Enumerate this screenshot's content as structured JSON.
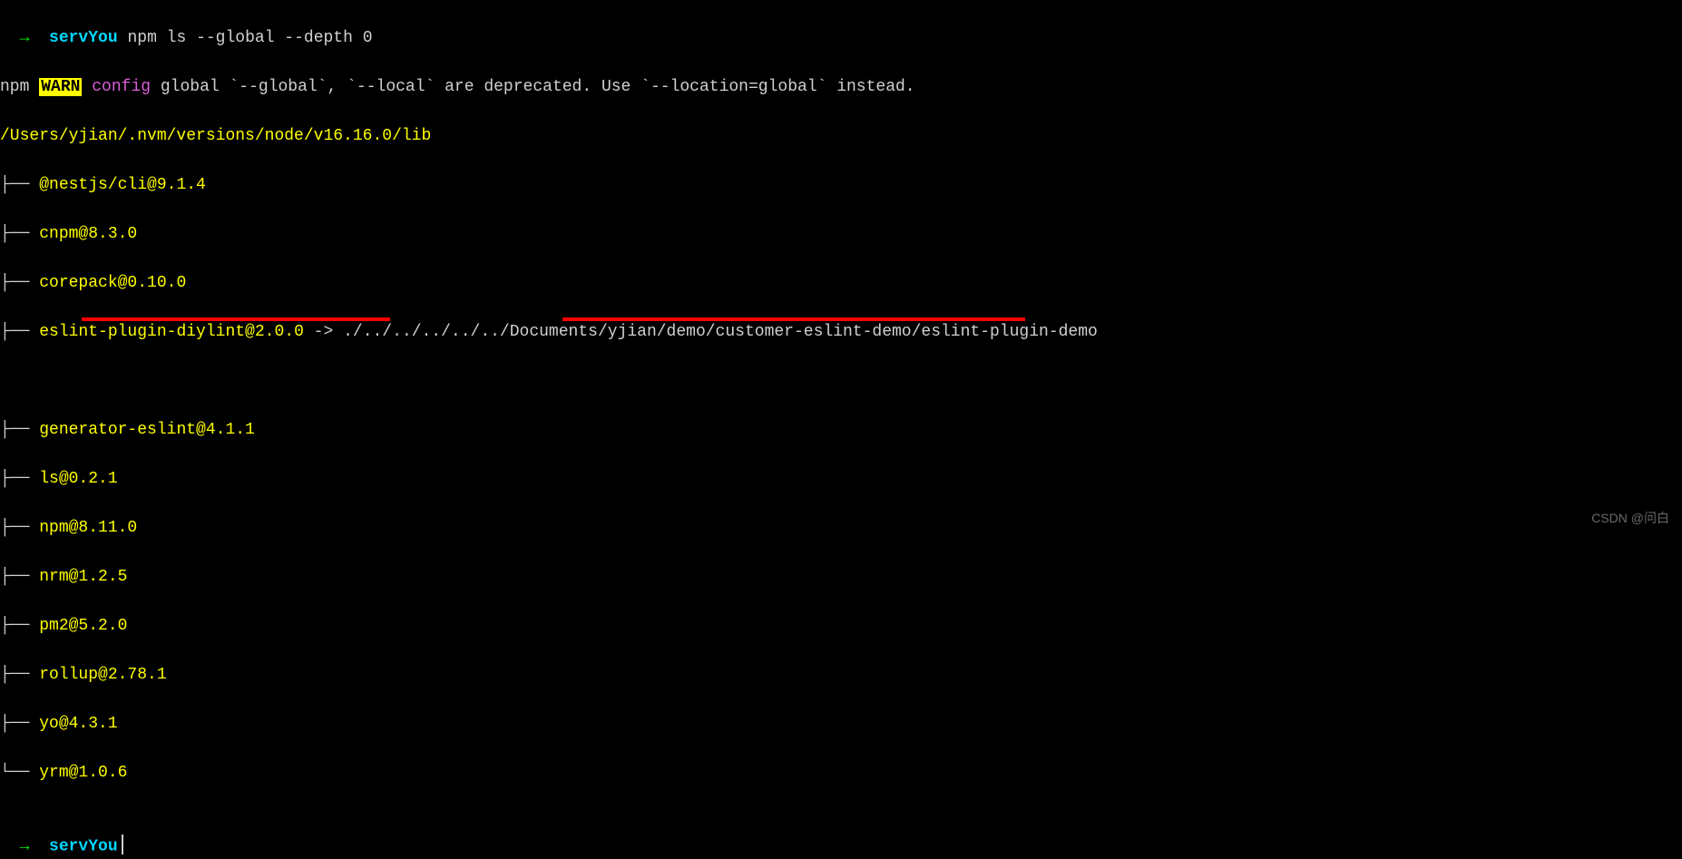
{
  "prompt": {
    "arrow": "→",
    "host": "servYou",
    "command": "npm ls --global --depth 0"
  },
  "warn": {
    "npm": "npm",
    "badge": "WARN",
    "config": "config",
    "message": "global `--global`, `--local` are deprecated. Use `--location=global` instead."
  },
  "root_path": "/Users/yjian/.nvm/versions/node/v16.16.0/lib",
  "tree": {
    "mid": "├── ",
    "last": "└── "
  },
  "packages": [
    "@nestjs/cli@9.1.4",
    "cnpm@8.3.0",
    "corepack@0.10.0",
    "eslint-plugin-diylint@2.0.0",
    "generator-eslint@4.1.1",
    "ls@0.2.1",
    "npm@8.11.0",
    "nrm@1.2.5",
    "pm2@5.2.0",
    "rollup@2.78.1",
    "yo@4.3.1",
    "yrm@1.0.6"
  ],
  "link": {
    "arrow": " -> ",
    "target": "./../../../../../Documents/yjian/demo/customer-eslint-demo/eslint-plugin-demo"
  },
  "watermark": "CSDN @问白"
}
